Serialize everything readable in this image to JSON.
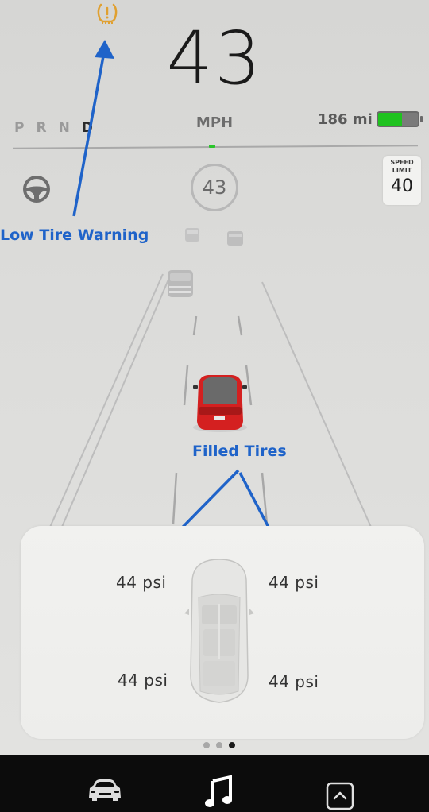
{
  "status": {
    "tpms_warning_icon": "tire-pressure-warning-icon",
    "tpms_warning_color": "#e0a030",
    "speed": "43",
    "speed_unit": "MPH",
    "gears": [
      "P",
      "R",
      "N",
      "D"
    ],
    "active_gear": "D",
    "range": "186 mi",
    "battery_level_percent": 60,
    "battery_color": "#1fc21f"
  },
  "driving": {
    "autosteer_icon": "steering-wheel-icon",
    "set_speed": "43",
    "speed_limit": {
      "label_line1": "SPEED",
      "label_line2": "LIMIT",
      "value": "40"
    }
  },
  "annotations": {
    "low_tire_warning": "Low Tire Warning",
    "filled_tires": "Filled Tires",
    "color": "#1f63c9"
  },
  "tire_pressure": {
    "front_left": "44 psi",
    "front_right": "44 psi",
    "rear_left": "44 psi",
    "rear_right": "44 psi"
  },
  "page_indicator": {
    "count": 3,
    "active_index": 2
  },
  "bottom_nav": [
    {
      "name": "car",
      "icon": "car-icon"
    },
    {
      "name": "music",
      "icon": "music-note-icon"
    },
    {
      "name": "apps",
      "icon": "chevron-up-icon"
    }
  ]
}
